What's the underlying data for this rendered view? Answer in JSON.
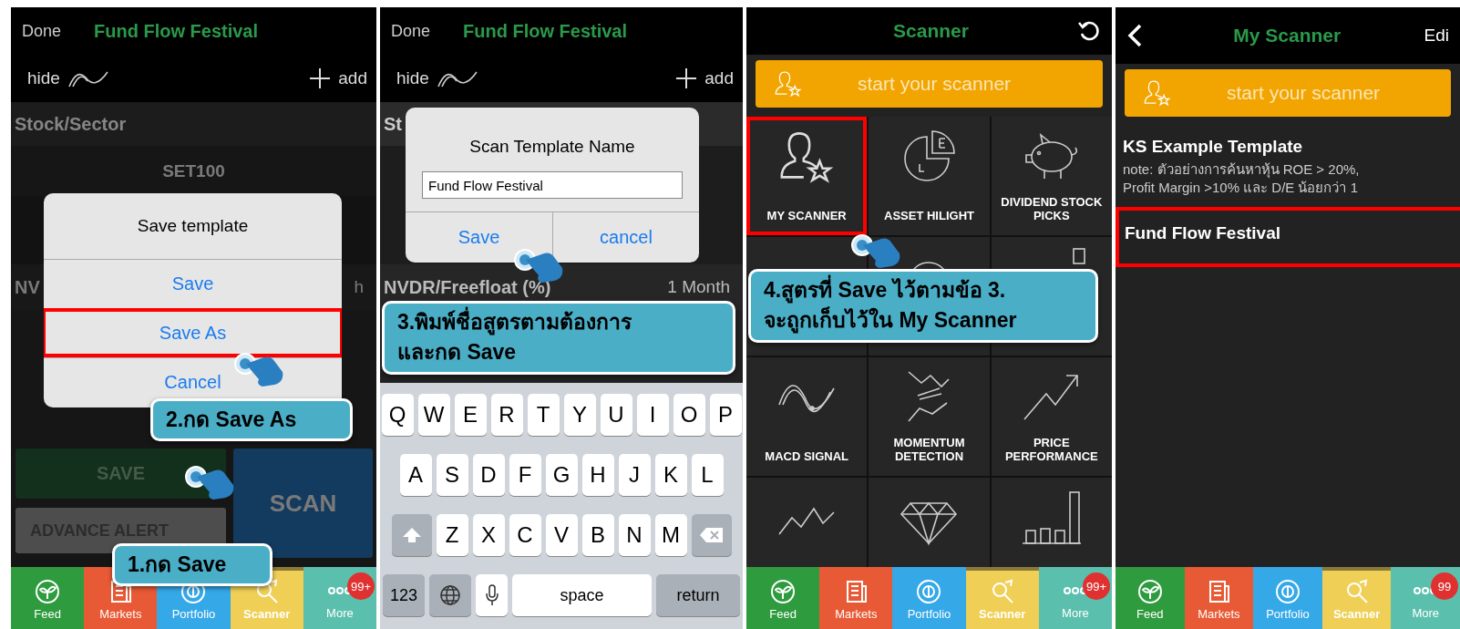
{
  "panels": [
    {
      "kind": "editor",
      "dimmed": true,
      "header": {
        "left": "Done",
        "title": "Fund Flow Festival"
      },
      "toolbar": {
        "hide": "hide",
        "add": "add"
      },
      "rows": [
        {
          "kind": "section",
          "label": "Stock/Sector"
        },
        {
          "kind": "value",
          "label": "SET100"
        },
        {
          "kind": "param",
          "label": "NV",
          "value": "h"
        }
      ],
      "buttons": [
        {
          "kind": "save",
          "label": "SAVE"
        },
        {
          "kind": "alert",
          "label": "ADVANCE ALERT"
        },
        {
          "kind": "scan",
          "label": "SCAN"
        }
      ],
      "dialog": {
        "kind": "actions",
        "title": "Save template",
        "actions": [
          {
            "label": "Save",
            "highlighted": false
          },
          {
            "label": "Save As",
            "highlighted": true
          },
          {
            "label": "Cancel",
            "highlighted": false
          }
        ]
      },
      "callouts": [
        {
          "lines": [
            "2.กด Save As"
          ]
        },
        {
          "lines": [
            "1.กด Save"
          ]
        }
      ],
      "tabs": [
        {
          "label": "Feed",
          "color": "#2e9b3e",
          "selected": false
        },
        {
          "label": "Markets",
          "color": "#e85a35",
          "selected": false
        },
        {
          "label": "Portfolio",
          "color": "#35a8e8",
          "selected": false
        },
        {
          "label": "Scanner",
          "color": "#efcf55",
          "selected": true
        },
        {
          "label": "More",
          "color": "#5bbfae",
          "selected": false,
          "badge": "99+"
        }
      ]
    },
    {
      "kind": "editor",
      "header": {
        "left": "Done",
        "title": "Fund Flow Festival"
      },
      "toolbar": {
        "hide": "hide",
        "add": "add"
      },
      "rows": [
        {
          "kind": "section",
          "label": "St"
        },
        {
          "kind": "param",
          "label": "NVDR/Freefloat (%)",
          "value": "1 Month"
        }
      ],
      "dialog": {
        "kind": "prompt",
        "title": "Scan Template Name",
        "value": "Fund Flow Festival",
        "buttons": [
          "Save",
          "cancel"
        ]
      },
      "callouts": [
        {
          "lines": [
            "3.พิมพ์ชื่อสูตรตามต้องการ",
            "และกด Save"
          ]
        }
      ],
      "keyboard": {
        "rows": [
          {
            "keys": [
              {
                "kind": "char",
                "label": "Q"
              },
              {
                "kind": "char",
                "label": "W"
              },
              {
                "kind": "char",
                "label": "E"
              },
              {
                "kind": "char",
                "label": "R"
              },
              {
                "kind": "char",
                "label": "T"
              },
              {
                "kind": "char",
                "label": "Y"
              },
              {
                "kind": "char",
                "label": "U"
              },
              {
                "kind": "char",
                "label": "I"
              },
              {
                "kind": "char",
                "label": "O"
              },
              {
                "kind": "char",
                "label": "P"
              }
            ]
          },
          {
            "keys": [
              {
                "kind": "char",
                "label": "A"
              },
              {
                "kind": "char",
                "label": "S"
              },
              {
                "kind": "char",
                "label": "D"
              },
              {
                "kind": "char",
                "label": "F"
              },
              {
                "kind": "char",
                "label": "G"
              },
              {
                "kind": "char",
                "label": "H"
              },
              {
                "kind": "char",
                "label": "J"
              },
              {
                "kind": "char",
                "label": "K"
              },
              {
                "kind": "char",
                "label": "L"
              }
            ]
          },
          {
            "keys": [
              {
                "kind": "shift"
              },
              {
                "kind": "char",
                "label": "Z"
              },
              {
                "kind": "char",
                "label": "X"
              },
              {
                "kind": "char",
                "label": "C"
              },
              {
                "kind": "char",
                "label": "V"
              },
              {
                "kind": "char",
                "label": "B"
              },
              {
                "kind": "char",
                "label": "N"
              },
              {
                "kind": "char",
                "label": "M"
              },
              {
                "kind": "delete"
              }
            ]
          },
          {
            "keys": [
              {
                "kind": "mode",
                "label": "123"
              },
              {
                "kind": "globe"
              },
              {
                "kind": "mic"
              },
              {
                "kind": "space",
                "label": "space"
              },
              {
                "kind": "return",
                "label": "return"
              }
            ]
          }
        ]
      }
    },
    {
      "kind": "scanner",
      "header": {
        "title": "Scanner"
      },
      "banner": "start your scanner",
      "grid": [
        {
          "label": "MY SCANNER",
          "highlighted": true
        },
        {
          "label": "ASSET HILIGHT",
          "highlighted": false
        },
        {
          "label": "DIVIDEND STOCK PICKS",
          "highlighted": false
        },
        {
          "highlighted": false
        },
        {
          "highlighted": false
        },
        {
          "highlighted": false
        },
        {
          "label": "MACD SIGNAL",
          "highlighted": false
        },
        {
          "label": "MOMENTUM DETECTION",
          "highlighted": false
        },
        {
          "label": "PRICE PERFORMANCE",
          "highlighted": false
        },
        {
          "highlighted": false
        },
        {
          "highlighted": false
        },
        {
          "highlighted": false
        }
      ],
      "callouts": [
        {
          "lines": [
            "4.สูตรที่ Save ไว้ตามข้อ 3.",
            "จะถูกเก็บไว้ใน My Scanner"
          ]
        }
      ],
      "tabs": [
        {
          "label": "Feed",
          "color": "#2e9b3e",
          "selected": false
        },
        {
          "label": "Markets",
          "color": "#e85a35",
          "selected": false
        },
        {
          "label": "Portfolio",
          "color": "#35a8e8",
          "selected": false
        },
        {
          "label": "Scanner",
          "color": "#efcf55",
          "selected": true
        },
        {
          "label": "More",
          "color": "#5bbfae",
          "selected": false,
          "badge": "99+"
        }
      ]
    },
    {
      "kind": "my_scanner",
      "header": {
        "title": "My Scanner",
        "right": "Edi"
      },
      "banner": "start your scanner",
      "templates": [
        {
          "name": "KS Example Template",
          "note": [
            "note: ตัวอย่างการค้นหาหุ้น ROE > 20%,",
            "Profit Margin >10% และ D/E น้อยกว่า 1"
          ],
          "highlighted": false
        },
        {
          "name": "Fund Flow Festival",
          "highlighted": true
        }
      ],
      "tabs": [
        {
          "label": "Feed",
          "color": "#2e9b3e",
          "selected": false
        },
        {
          "label": "Markets",
          "color": "#e85a35",
          "selected": false
        },
        {
          "label": "Portfolio",
          "color": "#35a8e8",
          "selected": false
        },
        {
          "label": "Scanner",
          "color": "#efcf55",
          "selected": true
        },
        {
          "label": "More",
          "color": "#5bbfae",
          "selected": false,
          "badge": "99"
        }
      ]
    }
  ]
}
